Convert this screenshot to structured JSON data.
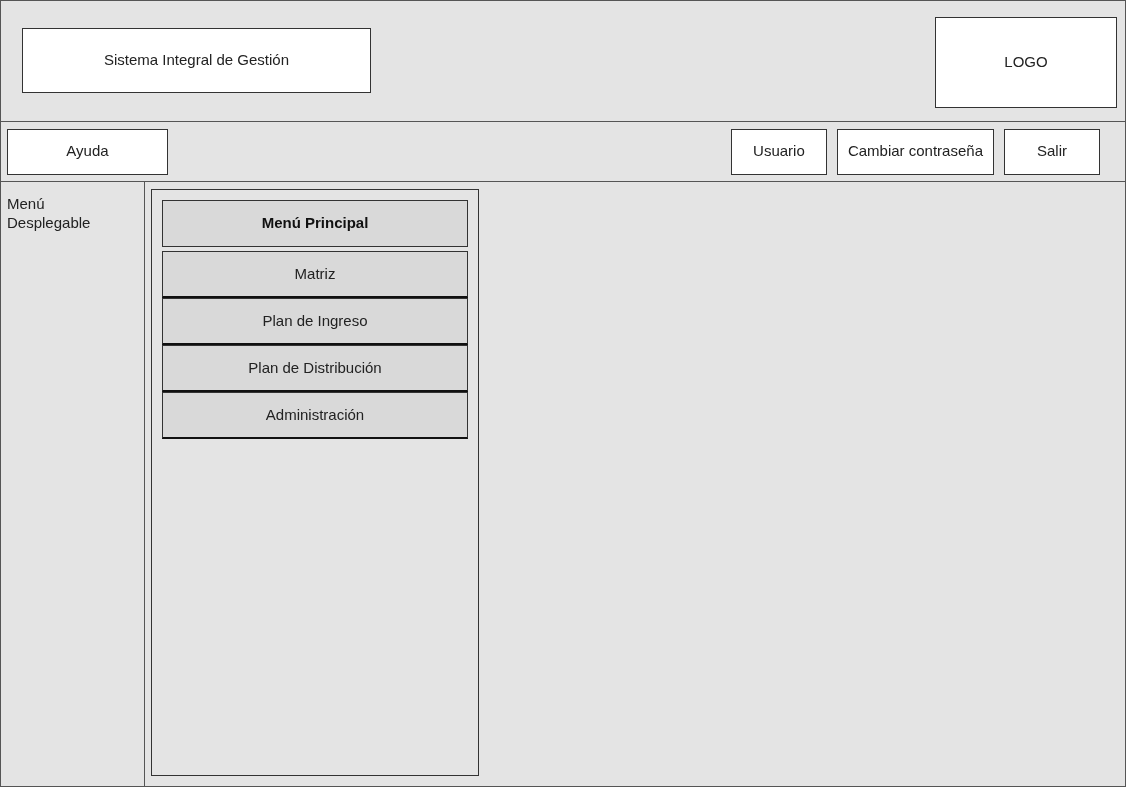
{
  "header": {
    "title": "Sistema Integral de Gestión",
    "logo": "LOGO"
  },
  "toolbar": {
    "left": [
      "Ayuda"
    ],
    "right": [
      "Usuario",
      "Cambiar contraseña",
      "Salir"
    ]
  },
  "sidebar": {
    "label": "Menú Desplegable"
  },
  "menu": [
    {
      "kind": "header",
      "label": "Menú Principal"
    },
    {
      "kind": "item",
      "label": "Matriz"
    },
    {
      "kind": "item",
      "label": "Plan de Ingreso"
    },
    {
      "kind": "item",
      "label": "Plan de Distribución"
    },
    {
      "kind": "item",
      "label": "Administración"
    }
  ]
}
